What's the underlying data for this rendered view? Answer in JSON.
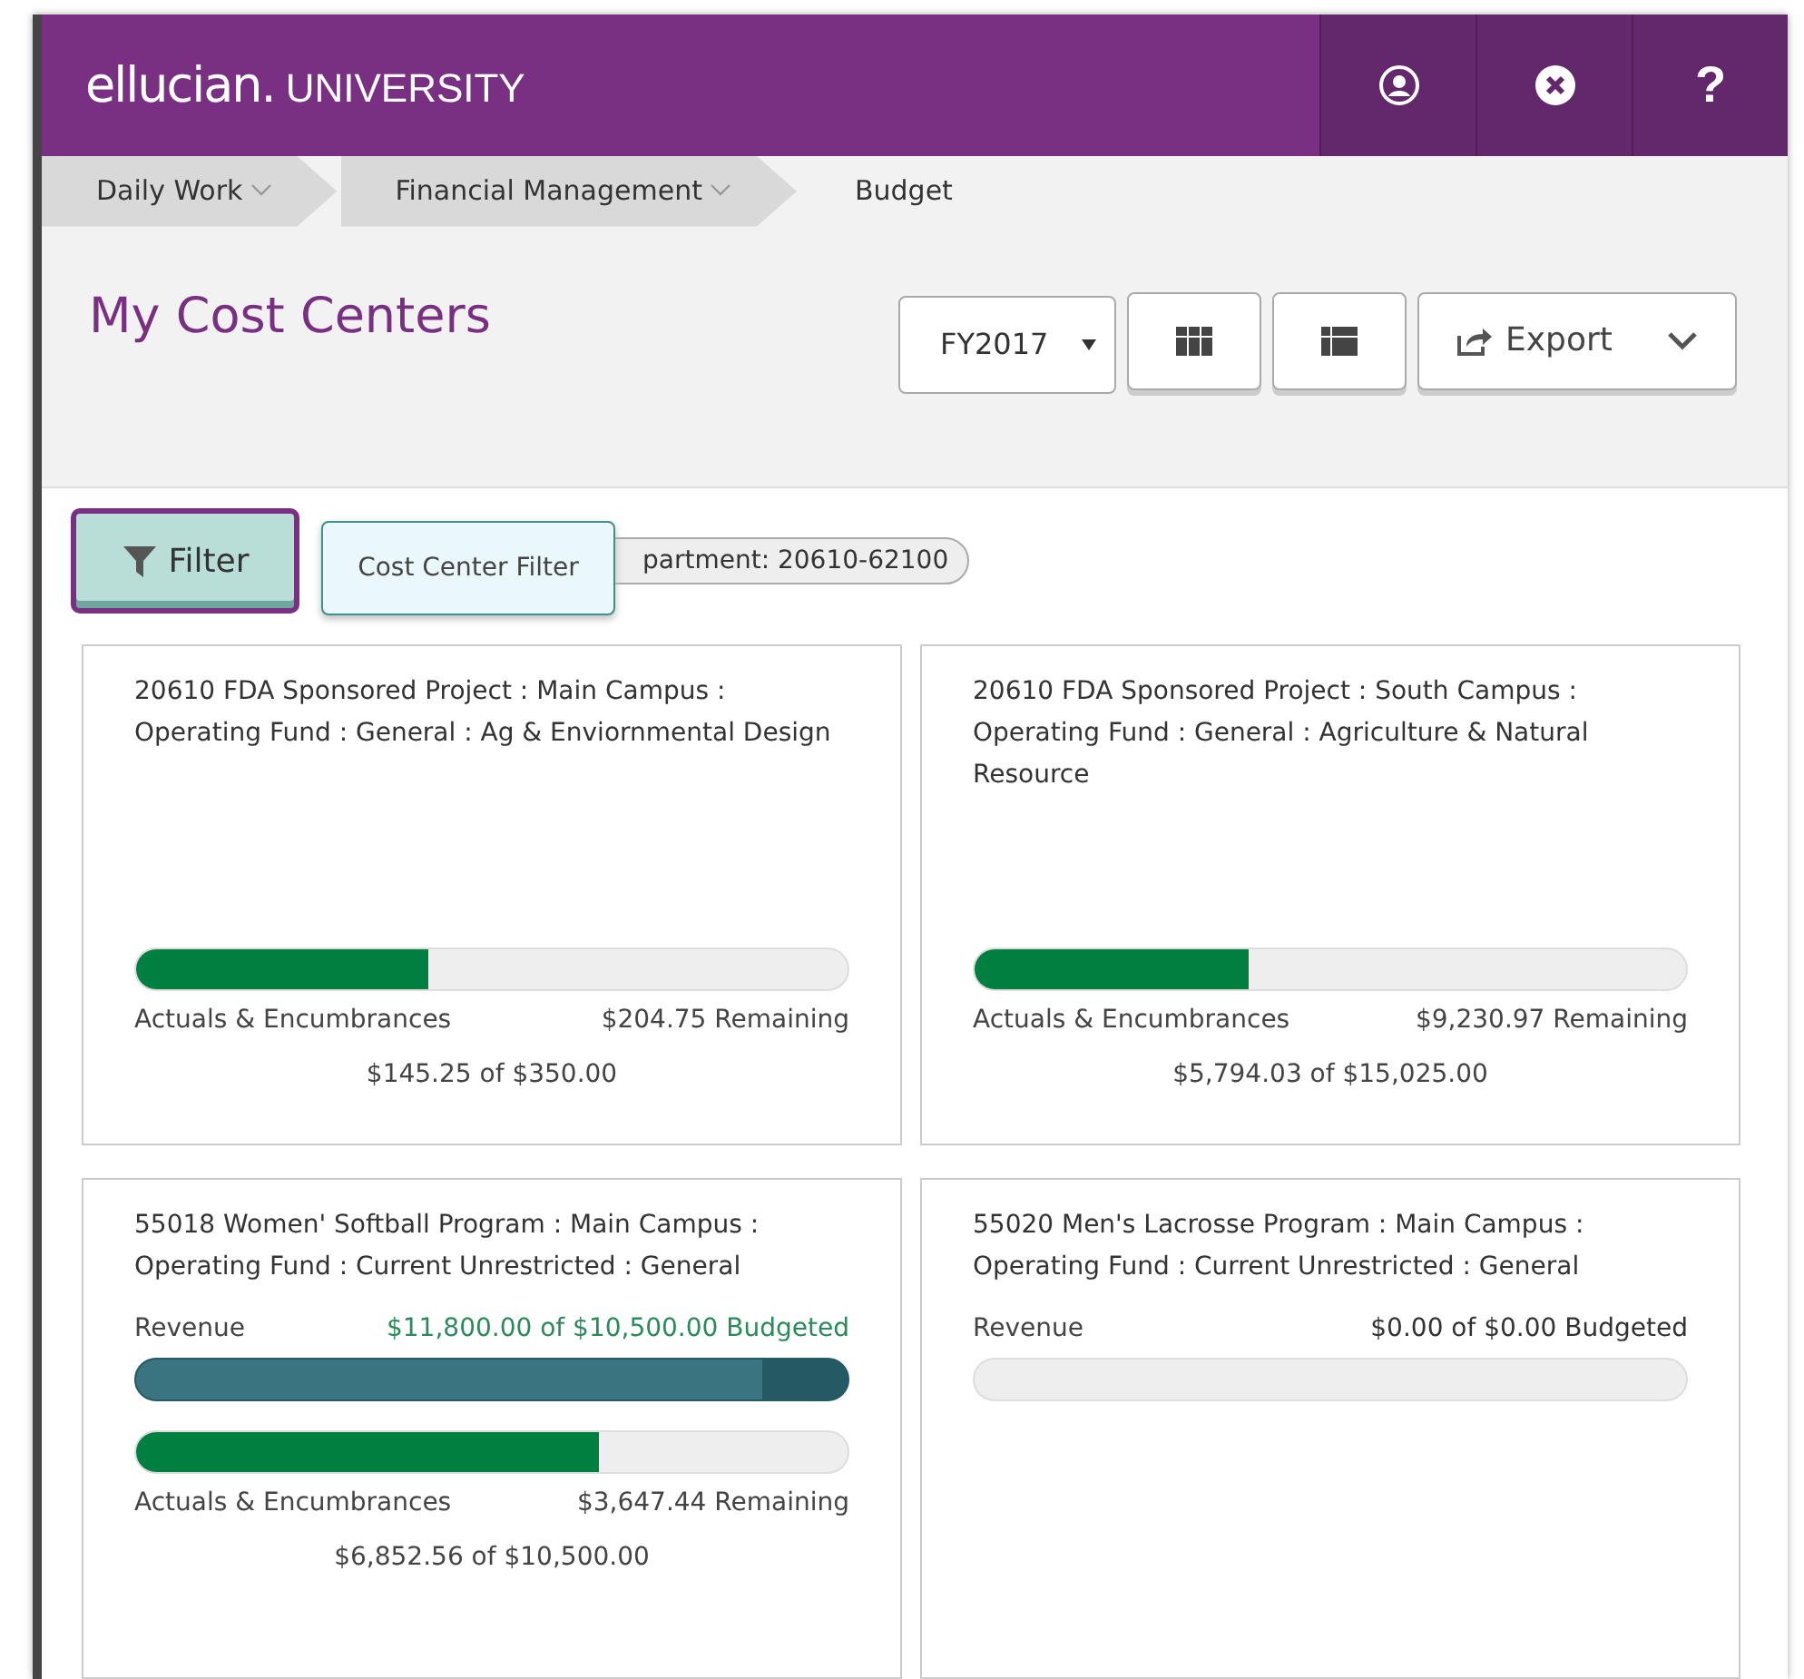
{
  "header": {
    "logo": "ellucian.",
    "logo_suffix": "UNIVERSITY",
    "help": "?"
  },
  "breadcrumbs": [
    {
      "label": "Daily Work",
      "dropdown": true
    },
    {
      "label": "Financial Management",
      "dropdown": true
    },
    {
      "label": "Budget",
      "dropdown": false
    }
  ],
  "page_title": "My Cost Centers",
  "year_select": {
    "value": "FY2017"
  },
  "view_buttons": [
    {
      "kind": "grid"
    },
    {
      "kind": "list"
    }
  ],
  "export_button": {
    "label": "Export"
  },
  "filter_button": {
    "label": "Filter"
  },
  "filter_chip": {
    "label": "partment: 20610-62100"
  },
  "tooltip": {
    "text": "Cost Center Filter"
  },
  "cards": [
    {
      "title": "20610 FDA Sponsored Project : Main Campus : Operating Fund : General : Ag & Enviornmental Design",
      "actuals": {
        "label": "Actuals & Encumbrances",
        "remaining": "$204.75 Remaining",
        "level": 0.41,
        "total": "$145.25 of $350.00"
      }
    },
    {
      "title": "20610 FDA Sponsored Project : South Campus : Operating Fund : General : Agriculture & Natural Resource",
      "actuals": {
        "label": "Actuals & Encumbrances",
        "remaining": "$9,230.97 Remaining",
        "level": 0.385,
        "total": "$5,794.03 of $15,025.00"
      }
    },
    {
      "title": "55018 Women' Softball Program : Main Campus : Operating Fund : Current Unrestricted : General",
      "revenue": {
        "label": "Revenue",
        "amount": "$11,800.00 of $10,500.00 Budgeted",
        "level": 0.88,
        "over": true
      },
      "actuals": {
        "label": "Actuals & Encumbrances",
        "remaining": "$3,647.44 Remaining",
        "level": 0.65,
        "total": "$6,852.56 of $10,500.00"
      }
    },
    {
      "title": "55020 Men's Lacrosse Program : Main Campus : Operating Fund : Current Unrestricted : General",
      "revenue": {
        "label": "Revenue",
        "amount": "$0.00 of $0.00 Budgeted",
        "over": false
      }
    }
  ]
}
